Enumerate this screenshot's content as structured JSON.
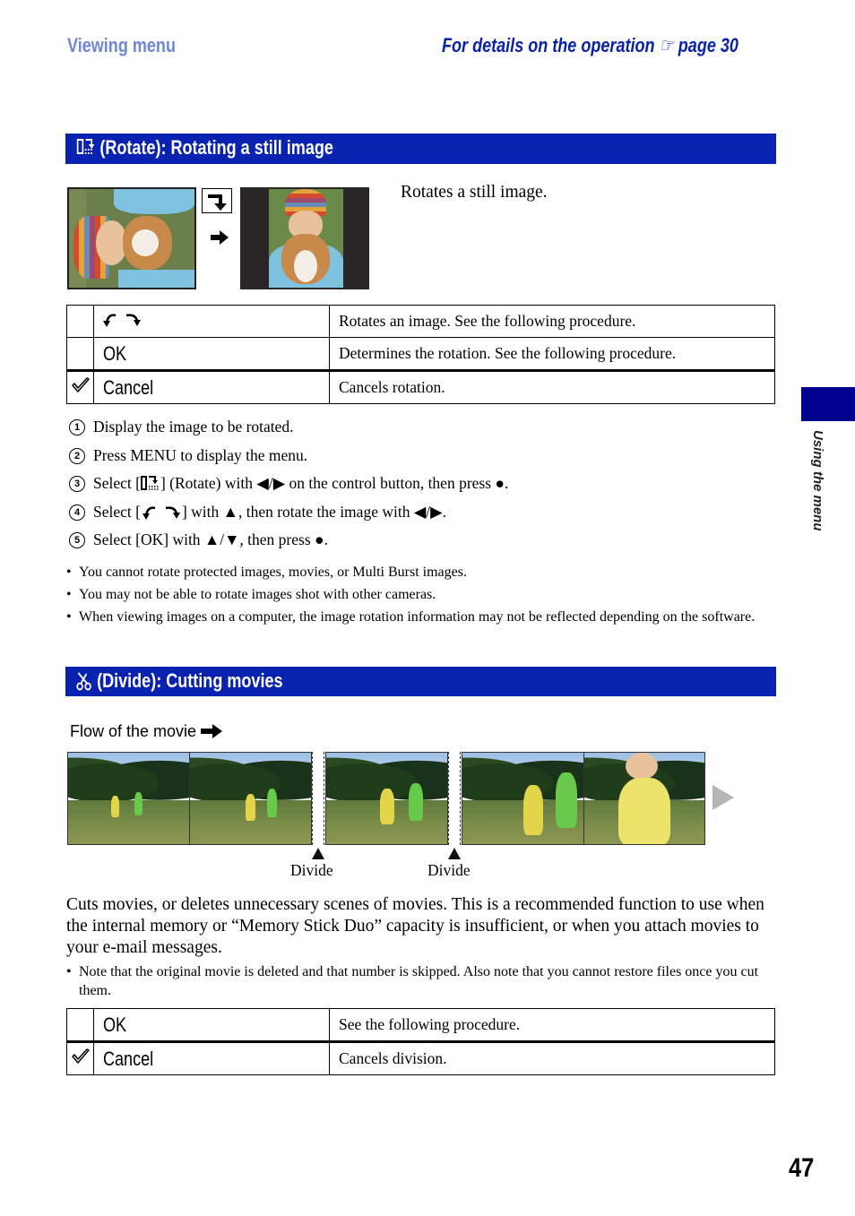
{
  "header": {
    "section": "Viewing menu",
    "details_prefix": "For details on the operation",
    "details_page": "page 30",
    "pointer_icon": "pointing-hand-icon"
  },
  "rotate_section": {
    "icon": "rotate-icon",
    "title": "(Rotate): Rotating a still image",
    "intro": "Rotates a still image.",
    "diagram_icons": [
      "rotate-clockwise-icon",
      "arrow-right-icon"
    ],
    "table": [
      {
        "selected": false,
        "option_icon": "rotate-both-icon",
        "option": "",
        "description": "Rotates an image. See the following procedure."
      },
      {
        "selected": false,
        "option": "OK",
        "description": "Determines the rotation. See the following procedure."
      },
      {
        "selected": true,
        "option": "Cancel",
        "description": "Cancels rotation."
      }
    ],
    "steps": [
      {
        "num": "1",
        "text": "Display the image to be rotated."
      },
      {
        "num": "2",
        "text": "Press MENU to display the menu."
      },
      {
        "num": "3",
        "pre": "Select [",
        "post": "] (Rotate) with ◀/▶ on the control button, then press ●."
      },
      {
        "num": "4",
        "pre": "Select [",
        "post": "] with ▲, then rotate the image with ◀/▶."
      },
      {
        "num": "5",
        "text": "Select [OK] with ▲/▼, then press ●."
      }
    ],
    "notes": [
      "You cannot rotate protected images, movies, or Multi Burst images.",
      "You may not be able to rotate images shot with other cameras.",
      "When viewing images on a computer, the image rotation information may not be reflected depending on the software."
    ]
  },
  "divide_section": {
    "icon": "scissors-icon",
    "title": "(Divide): Cutting movies",
    "flow_label": "Flow of the movie",
    "divide_labels": [
      "Divide",
      "Divide"
    ],
    "description": "Cuts movies, or deletes unnecessary scenes of movies. This is a recommended function to use when the internal memory or “Memory Stick Duo” capacity is insufficient, or when you attach movies to your e-mail messages.",
    "notes": [
      "Note that the original movie is deleted and that number is skipped. Also note that you cannot restore files once you cut them."
    ],
    "table": [
      {
        "selected": false,
        "option": "OK",
        "description": "See the following procedure."
      },
      {
        "selected": true,
        "option": "Cancel",
        "description": "Cancels division."
      }
    ]
  },
  "side_tab": {
    "label": "Using the menu",
    "color": "#00008f"
  },
  "page_number": "47",
  "colors": {
    "section_bar": "#0a22b0",
    "header_left": "#6f86d6",
    "header_right": "#0a22a8"
  }
}
